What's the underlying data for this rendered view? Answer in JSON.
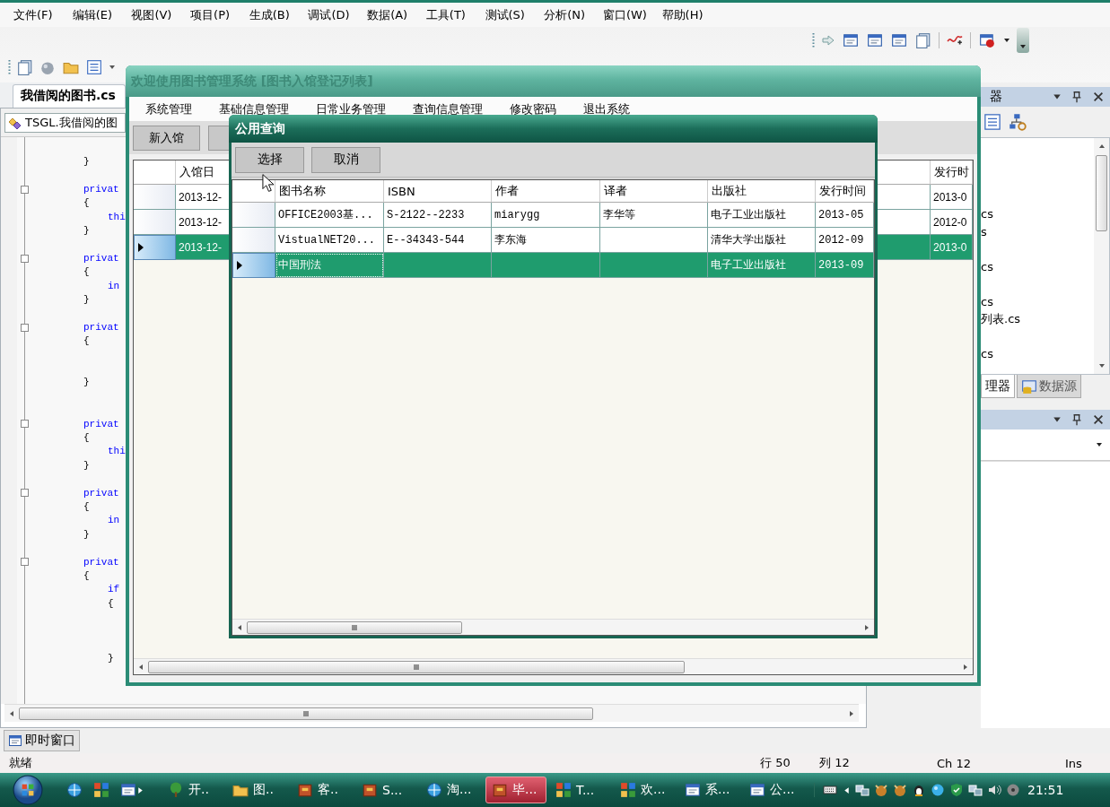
{
  "ide": {
    "menu": [
      "文件(F)",
      "编辑(E)",
      "视图(V)",
      "项目(P)",
      "生成(B)",
      "调试(D)",
      "数据(A)",
      "工具(T)",
      "测试(S)",
      "分析(N)",
      "窗口(W)",
      "帮助(H)"
    ],
    "document_tab": "我借阅的图书.cs",
    "editor": {
      "type_selector": "TSGL.我借阅的图",
      "lines": [
        {
          "kind": "member",
          "text": "}",
          "keyword": false,
          "foldable": false
        },
        {
          "kind": "blank",
          "foldable": false
        },
        {
          "kind": "member",
          "text": "privat",
          "keyword": true,
          "foldable": true
        },
        {
          "kind": "member",
          "text": "{",
          "keyword": false,
          "foldable": false
        },
        {
          "kind": "statement",
          "text": "thi",
          "keyword": true,
          "foldable": false
        },
        {
          "kind": "member",
          "text": "}",
          "keyword": false,
          "foldable": false
        },
        {
          "kind": "blank",
          "foldable": false
        },
        {
          "kind": "member",
          "text": "privat",
          "keyword": true,
          "foldable": true
        },
        {
          "kind": "member",
          "text": "{",
          "keyword": false,
          "foldable": false
        },
        {
          "kind": "statement",
          "text": "in",
          "keyword": true,
          "foldable": false
        },
        {
          "kind": "member",
          "text": "}",
          "keyword": false,
          "foldable": false
        },
        {
          "kind": "blank",
          "foldable": false
        },
        {
          "kind": "member",
          "text": "privat",
          "keyword": true,
          "foldable": true
        },
        {
          "kind": "member",
          "text": "{",
          "keyword": false,
          "foldable": false
        },
        {
          "kind": "blank",
          "foldable": false
        },
        {
          "kind": "blank",
          "foldable": false
        },
        {
          "kind": "member",
          "text": "}",
          "keyword": false,
          "foldable": false
        },
        {
          "kind": "blank",
          "foldable": false
        },
        {
          "kind": "blank",
          "foldable": false
        },
        {
          "kind": "member",
          "text": "privat",
          "keyword": true,
          "foldable": true
        },
        {
          "kind": "member",
          "text": "{",
          "keyword": false,
          "foldable": false
        },
        {
          "kind": "statement",
          "text": "thi",
          "keyword": true,
          "foldable": false
        },
        {
          "kind": "member",
          "text": "}",
          "keyword": false,
          "foldable": false
        },
        {
          "kind": "blank",
          "foldable": false
        },
        {
          "kind": "member",
          "text": "privat",
          "keyword": true,
          "foldable": true
        },
        {
          "kind": "member",
          "text": "{",
          "keyword": false,
          "foldable": false
        },
        {
          "kind": "statement",
          "text": "in",
          "keyword": true,
          "foldable": false
        },
        {
          "kind": "member",
          "text": "}",
          "keyword": false,
          "foldable": false
        },
        {
          "kind": "blank",
          "foldable": false
        },
        {
          "kind": "member",
          "text": "privat",
          "keyword": true,
          "foldable": true
        },
        {
          "kind": "member",
          "text": "{",
          "keyword": false,
          "foldable": false
        },
        {
          "kind": "statement",
          "text": "if",
          "keyword": true,
          "foldable": false
        },
        {
          "kind": "statement",
          "text": "{",
          "keyword": false,
          "foldable": false
        },
        {
          "kind": "blank",
          "foldable": false
        },
        {
          "kind": "blank",
          "foldable": false
        },
        {
          "kind": "blank",
          "foldable": false
        },
        {
          "kind": "statement",
          "text": "}",
          "keyword": false,
          "foldable": false
        }
      ]
    },
    "solution_panel": {
      "title": "器",
      "files": [
        {
          "kind": "file",
          "text": "cs"
        },
        {
          "kind": "file",
          "text": "s"
        },
        {
          "kind": "blank"
        },
        {
          "kind": "file",
          "text": "cs"
        },
        {
          "kind": "blank"
        },
        {
          "kind": "file",
          "text": "cs"
        },
        {
          "kind": "file",
          "text": "列表.cs"
        },
        {
          "kind": "blank"
        },
        {
          "kind": "file",
          "text": "cs"
        }
      ],
      "tabs": [
        {
          "label": "理器",
          "selected": true
        },
        {
          "label": "数据源",
          "selected": false
        }
      ]
    },
    "immediate_tab": "即时窗口",
    "status_bar": {
      "message": "就绪",
      "line": "行 50",
      "column": "列 12",
      "char": "Ch 12",
      "mode": "Ins"
    }
  },
  "app_window": {
    "title": "欢迎使用图书管理系统 [图书入馆登记列表]",
    "menu": [
      "系统管理",
      "基础信息管理",
      "日常业务管理",
      "查询信息管理",
      "修改密码",
      "退出系统"
    ],
    "buttons": [
      "新入馆"
    ],
    "grid": {
      "columns": [
        "入馆日",
        "发行时"
      ],
      "rows": [
        {
          "cells": [
            "2013-12-",
            "2013-0"
          ],
          "selected": false
        },
        {
          "cells": [
            "2013-12-",
            "2012-0"
          ],
          "selected": false
        },
        {
          "cells": [
            "2013-12-",
            "2013-0"
          ],
          "selected": true
        }
      ]
    }
  },
  "dialog": {
    "title": "公用查询",
    "buttons": [
      "选择",
      "取消"
    ],
    "grid": {
      "columns": [
        "图书名称",
        "ISBN",
        "作者",
        "译者",
        "出版社",
        "发行时间"
      ],
      "rows": [
        {
          "cells": [
            "OFFICE2003基...",
            "S-2122--2233",
            "miarygg",
            "李华等",
            "电子工业出版社",
            "2013-05"
          ],
          "selected": false
        },
        {
          "cells": [
            "VistualNET20...",
            "E--34343-544",
            "李东海",
            "",
            "清华大学出版社",
            "2012-09"
          ],
          "selected": false
        },
        {
          "cells": [
            "中国刑法",
            "",
            "",
            "",
            "电子工业出版社",
            "2013-09"
          ],
          "selected": true
        }
      ]
    }
  },
  "taskbar": {
    "tasks": [
      {
        "label": "开..",
        "selected": false
      },
      {
        "label": "图..",
        "selected": false
      },
      {
        "label": "客..",
        "selected": false
      },
      {
        "label": "S...",
        "selected": false
      },
      {
        "label": "淘...",
        "selected": false
      },
      {
        "label": "毕...",
        "selected": true
      },
      {
        "label": "T...",
        "selected": false
      },
      {
        "label": "欢...",
        "selected": false
      },
      {
        "label": "系...",
        "selected": false
      },
      {
        "label": "公...",
        "selected": false
      }
    ],
    "clock": "21:51"
  }
}
